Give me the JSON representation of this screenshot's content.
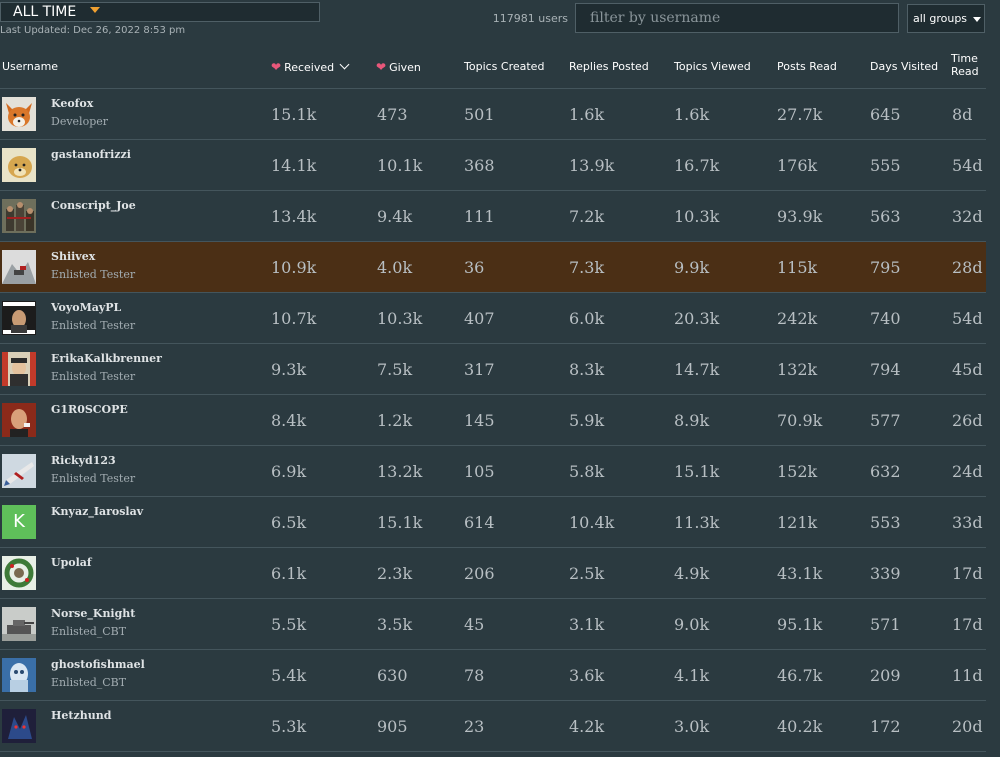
{
  "controls": {
    "period_label": "ALL TIME",
    "last_updated": "Last Updated: Dec 26, 2022 8:53 pm",
    "user_count": "117981 users",
    "filter_placeholder": "filter by username",
    "groups_label": "all groups"
  },
  "headers": {
    "username": "Username",
    "received": "Received",
    "given": "Given",
    "topics_created": "Topics Created",
    "replies_posted": "Replies Posted",
    "topics_viewed": "Topics Viewed",
    "posts_read": "Posts Read",
    "days_visited": "Days Visited",
    "time_read_1": "Time",
    "time_read_2": "Read"
  },
  "colors": {
    "background": "#2b3a40",
    "highlight_row": "#4b2f15",
    "heart": "#e8577a",
    "caret_accent": "#f0a030"
  },
  "rows": [
    {
      "username": "Keofox",
      "title": "Developer",
      "received": "15.1k",
      "given": "473",
      "topics_created": "501",
      "replies_posted": "1.6k",
      "topics_viewed": "1.6k",
      "posts_read": "27.7k",
      "days_visited": "645",
      "time_read": "8d",
      "avatar": "fox-avatar"
    },
    {
      "username": "gastanofrizzi",
      "title": "",
      "received": "14.1k",
      "given": "10.1k",
      "topics_created": "368",
      "replies_posted": "13.9k",
      "topics_viewed": "16.7k",
      "posts_read": "176k",
      "days_visited": "555",
      "time_read": "54d",
      "avatar": "dog-avatar"
    },
    {
      "username": "Conscript_Joe",
      "title": "",
      "received": "13.4k",
      "given": "9.4k",
      "topics_created": "111",
      "replies_posted": "7.2k",
      "topics_viewed": "10.3k",
      "posts_read": "93.9k",
      "days_visited": "563",
      "time_read": "32d",
      "avatar": "soldiers-avatar"
    },
    {
      "username": "Shiivex",
      "title": "Enlisted Tester",
      "received": "10.9k",
      "given": "4.0k",
      "topics_created": "36",
      "replies_posted": "7.3k",
      "topics_viewed": "9.9k",
      "posts_read": "115k",
      "days_visited": "795",
      "time_read": "28d",
      "avatar": "mountain-avatar",
      "highlighted": true
    },
    {
      "username": "VoyoMayPL",
      "title": "Enlisted Tester",
      "received": "10.7k",
      "given": "10.3k",
      "topics_created": "407",
      "replies_posted": "6.0k",
      "topics_viewed": "20.3k",
      "posts_read": "242k",
      "days_visited": "740",
      "time_read": "54d",
      "avatar": "meme-avatar"
    },
    {
      "username": "ErikaKalkbrenner",
      "title": "Enlisted Tester",
      "received": "9.3k",
      "given": "7.5k",
      "topics_created": "317",
      "replies_posted": "8.3k",
      "topics_viewed": "14.7k",
      "posts_read": "132k",
      "days_visited": "794",
      "time_read": "45d",
      "avatar": "officer-avatar"
    },
    {
      "username": "G1R0SCOPE",
      "title": "",
      "received": "8.4k",
      "given": "1.2k",
      "topics_created": "145",
      "replies_posted": "5.9k",
      "topics_viewed": "8.9k",
      "posts_read": "70.9k",
      "days_visited": "577",
      "time_read": "26d",
      "avatar": "man-avatar"
    },
    {
      "username": "Rickyd123",
      "title": "Enlisted Tester",
      "received": "6.9k",
      "given": "13.2k",
      "topics_created": "105",
      "replies_posted": "5.8k",
      "topics_viewed": "15.1k",
      "posts_read": "152k",
      "days_visited": "632",
      "time_read": "24d",
      "avatar": "aircraft-avatar"
    },
    {
      "username": "Knyaz_Iaroslav",
      "title": "",
      "received": "6.5k",
      "given": "15.1k",
      "topics_created": "614",
      "replies_posted": "10.4k",
      "topics_viewed": "11.3k",
      "posts_read": "121k",
      "days_visited": "553",
      "time_read": "33d",
      "avatar": "letter-k-avatar",
      "avatar_letter": "K"
    },
    {
      "username": "Upolaf",
      "title": "",
      "received": "6.1k",
      "given": "2.3k",
      "topics_created": "206",
      "replies_posted": "2.5k",
      "topics_viewed": "4.9k",
      "posts_read": "43.1k",
      "days_visited": "339",
      "time_read": "17d",
      "avatar": "wreath-avatar"
    },
    {
      "username": "Norse_Knight",
      "title": "Enlisted_CBT",
      "received": "5.5k",
      "given": "3.5k",
      "topics_created": "45",
      "replies_posted": "3.1k",
      "topics_viewed": "9.0k",
      "posts_read": "95.1k",
      "days_visited": "571",
      "time_read": "17d",
      "avatar": "tank-avatar"
    },
    {
      "username": "ghostofishmael",
      "title": "Enlisted_CBT",
      "received": "5.4k",
      "given": "630",
      "topics_created": "78",
      "replies_posted": "3.6k",
      "topics_viewed": "4.1k",
      "posts_read": "46.7k",
      "days_visited": "209",
      "time_read": "11d",
      "avatar": "ghost-avatar"
    },
    {
      "username": "Hetzhund",
      "title": "",
      "received": "5.3k",
      "given": "905",
      "topics_created": "23",
      "replies_posted": "4.2k",
      "topics_viewed": "3.0k",
      "posts_read": "40.2k",
      "days_visited": "172",
      "time_read": "20d",
      "avatar": "wolf-avatar"
    }
  ]
}
